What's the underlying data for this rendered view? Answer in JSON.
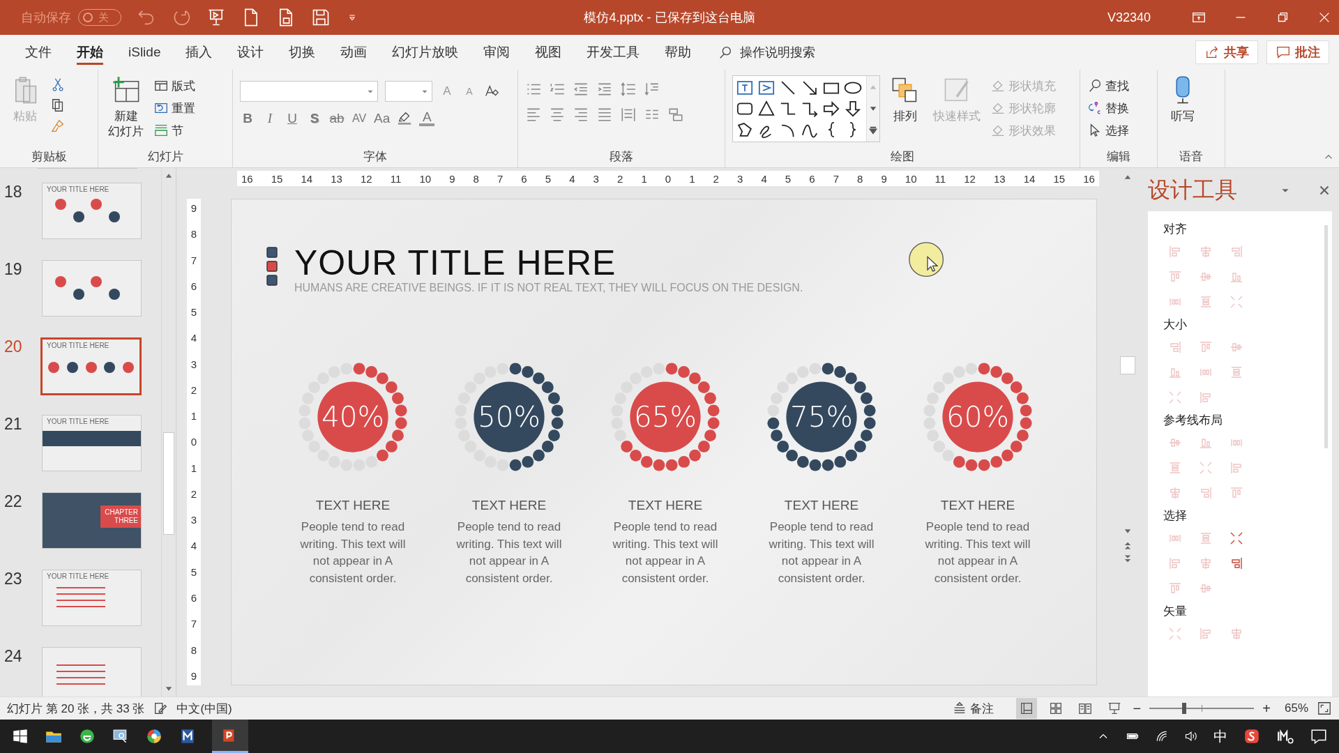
{
  "title_bar": {
    "autosave_label": "自动保存",
    "autosave_state": "关",
    "autosave_on": false,
    "document_title": "模仿4.pptx  -  已保存到这台电脑",
    "version": "V32340"
  },
  "ribbon_tabs": [
    {
      "label": "文件",
      "selected": false
    },
    {
      "label": "开始",
      "selected": true
    },
    {
      "label": "iSlide",
      "selected": false
    },
    {
      "label": "插入",
      "selected": false
    },
    {
      "label": "设计",
      "selected": false
    },
    {
      "label": "切换",
      "selected": false
    },
    {
      "label": "动画",
      "selected": false
    },
    {
      "label": "幻灯片放映",
      "selected": false
    },
    {
      "label": "审阅",
      "selected": false
    },
    {
      "label": "视图",
      "selected": false
    },
    {
      "label": "开发工具",
      "selected": false
    },
    {
      "label": "帮助",
      "selected": false
    }
  ],
  "tell_me": {
    "placeholder": "操作说明搜索"
  },
  "share": "共享",
  "comment": "批注",
  "groups": [
    "剪贴板",
    "幻灯片",
    "字体",
    "段落",
    "绘图",
    "编辑",
    "语音"
  ],
  "clipboard": {
    "paste": "粘贴",
    "paste_disabled": true
  },
  "slides_group": {
    "new_slide_line1": "新建",
    "new_slide_line2": "幻灯片",
    "layout": "版式",
    "reset": "重置",
    "section": "节"
  },
  "font_top": [
    {
      "label": "A",
      "kind": "grow"
    },
    {
      "label": "A",
      "kind": "shrink"
    }
  ],
  "font_buttons": [
    {
      "label": "B",
      "kind": "bold"
    },
    {
      "label": "I",
      "kind": "italic"
    },
    {
      "label": "U",
      "kind": "underline"
    },
    {
      "label": "S",
      "kind": "shadow"
    },
    {
      "label": "ab",
      "kind": "strike"
    },
    {
      "label": "AV",
      "kind": "spacing"
    },
    {
      "label": "Aa",
      "kind": "case"
    },
    {
      "label": "A",
      "kind": "color"
    }
  ],
  "drawing": {
    "arrange": "排列",
    "quick_styles": "快速样式",
    "quick_styles_disabled": true,
    "shape_tools": [
      {
        "label": "形状填充",
        "disabled": true
      },
      {
        "label": "形状轮廓",
        "disabled": true
      },
      {
        "label": "形状效果",
        "disabled": true
      }
    ]
  },
  "editing": {
    "find": "查找",
    "replace": "替换",
    "select": "选择"
  },
  "voice": {
    "dictate": "听写"
  },
  "thumbnails": [
    {
      "number": "18",
      "selected": false,
      "kind": "steps",
      "title": "YOUR TITLE HERE"
    },
    {
      "number": "19",
      "selected": false,
      "kind": "steps"
    },
    {
      "number": "20",
      "selected": true,
      "kind": "rings",
      "title": "YOUR TITLE HERE"
    },
    {
      "number": "21",
      "selected": false,
      "kind": "banner",
      "title": "YOUR TITLE HERE"
    },
    {
      "number": "22",
      "selected": false,
      "kind": "chapter",
      "title": "CHAPTER THREE"
    },
    {
      "number": "23",
      "selected": false,
      "kind": "bars",
      "title": "YOUR TITLE HERE"
    },
    {
      "number": "24",
      "selected": false,
      "kind": "bars"
    }
  ],
  "h_ruler": [
    "16",
    "15",
    "14",
    "13",
    "12",
    "11",
    "10",
    "9",
    "8",
    "7",
    "6",
    "5",
    "4",
    "3",
    "2",
    "1",
    "0",
    "1",
    "2",
    "3",
    "4",
    "5",
    "6",
    "7",
    "8",
    "9",
    "10",
    "11",
    "12",
    "13",
    "14",
    "15",
    "16"
  ],
  "v_ruler": [
    "9",
    "8",
    "7",
    "6",
    "5",
    "4",
    "3",
    "2",
    "1",
    "0",
    "1",
    "2",
    "3",
    "4",
    "5",
    "6",
    "7",
    "8",
    "9"
  ],
  "slide": {
    "title": "YOUR TITLE HERE",
    "subtitle": "HUMANS ARE CREATIVE BEINGS. IF IT IS NOT REAL TEXT, THEY WILL FOCUS ON THE DESIGN.",
    "stats": [
      {
        "value": "40%",
        "color": "#d94b4b",
        "heading": "TEXT HERE",
        "body": "People tend to read writing. This text will not appear in A consistent order."
      },
      {
        "value": "50%",
        "color": "#34495e",
        "heading": "TEXT HERE",
        "body": "People tend to read writing. This text will not appear in A consistent order."
      },
      {
        "value": "65%",
        "color": "#d94b4b",
        "heading": "TEXT HERE",
        "body": "People tend to read writing. This text will not appear in A consistent order."
      },
      {
        "value": "75%",
        "color": "#34495e",
        "heading": "TEXT HERE",
        "body": "People tend to read writing. This text will not appear in A consistent order."
      },
      {
        "value": "60%",
        "color": "#d94b4b",
        "heading": "TEXT HERE",
        "body": "People tend to read writing. This text will not appear in A consistent order."
      }
    ]
  },
  "design_panel": {
    "title": "设计工具",
    "sections": [
      {
        "label": "对齐",
        "tools": [
          {
            "enabled": false
          },
          {
            "enabled": false
          },
          {
            "enabled": false
          },
          {
            "enabled": false
          },
          {
            "enabled": false
          },
          {
            "enabled": false
          },
          {
            "enabled": false
          },
          {
            "enabled": false
          },
          {
            "enabled": false
          }
        ]
      },
      {
        "label": "大小",
        "tools": [
          {
            "enabled": false
          },
          {
            "enabled": false
          },
          {
            "enabled": false
          },
          {
            "enabled": false
          },
          {
            "enabled": false
          },
          {
            "enabled": false
          },
          {
            "enabled": false
          },
          {
            "enabled": false
          }
        ]
      },
      {
        "label": "参考线布局",
        "tools": [
          {
            "enabled": false
          },
          {
            "enabled": false
          },
          {
            "enabled": false
          },
          {
            "enabled": false
          },
          {
            "enabled": false
          },
          {
            "enabled": false
          },
          {
            "enabled": false
          },
          {
            "enabled": false
          },
          {
            "enabled": false
          }
        ]
      },
      {
        "label": "选择",
        "tools": [
          {
            "enabled": false
          },
          {
            "enabled": false
          },
          {
            "enabled": true
          },
          {
            "enabled": false
          },
          {
            "enabled": false
          },
          {
            "enabled": true
          },
          {
            "enabled": false
          },
          {
            "enabled": false
          }
        ]
      },
      {
        "label": "矢量",
        "tools": [
          {
            "enabled": false
          },
          {
            "enabled": false
          },
          {
            "enabled": false
          }
        ]
      }
    ]
  },
  "status_bar": {
    "slide_info": "幻灯片 第 20 张，共 33 张",
    "language": "中文(中国)",
    "notes": "备注",
    "zoom_out": "−",
    "zoom_in": "+",
    "zoom_slider": {
      "level": 0.33
    },
    "zoom": "65%"
  },
  "taskbar": {
    "ime": "中"
  }
}
